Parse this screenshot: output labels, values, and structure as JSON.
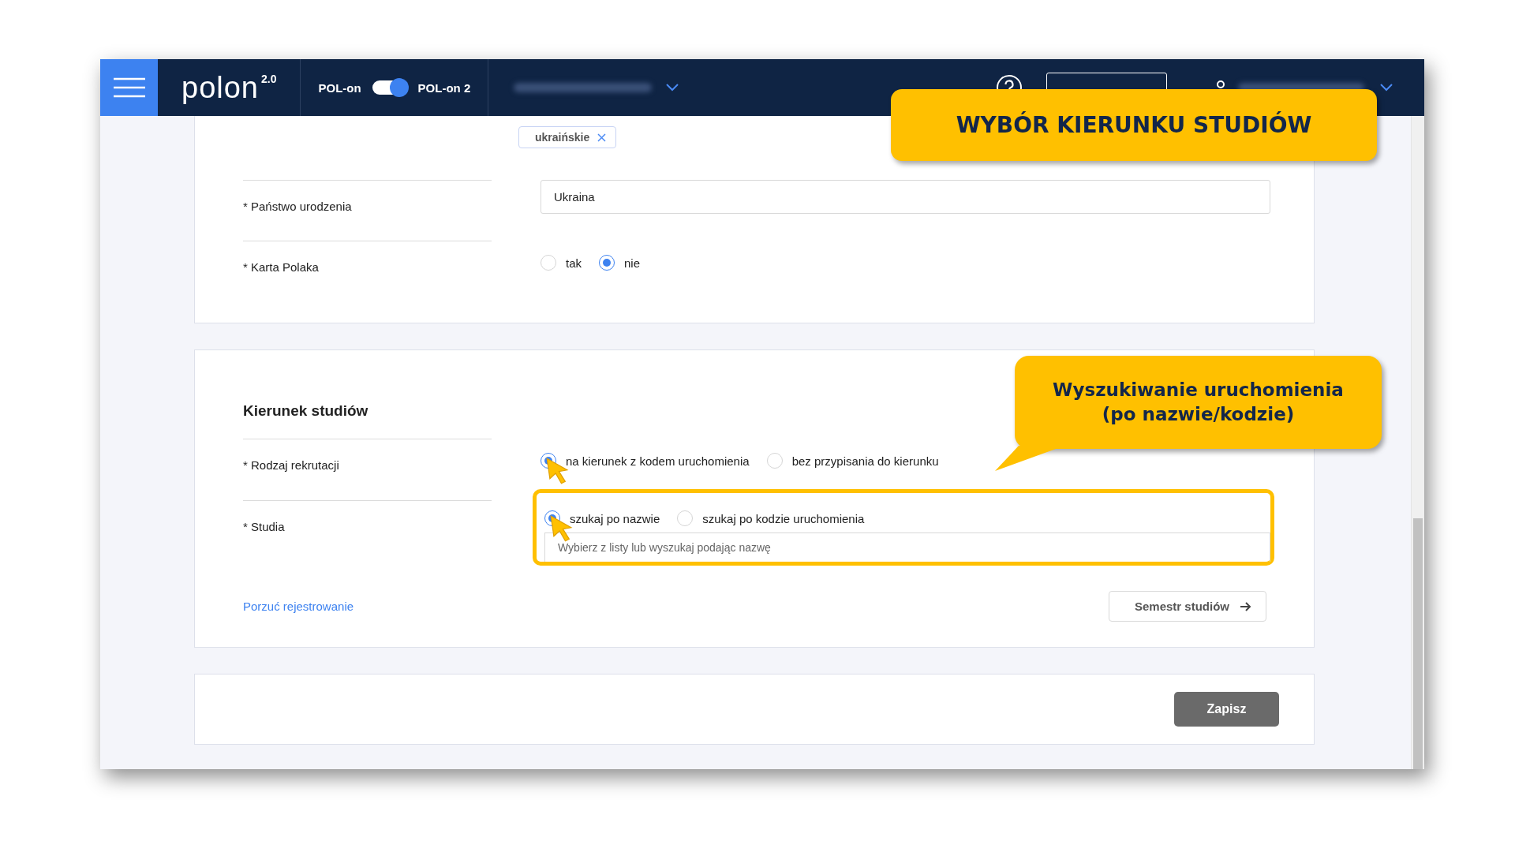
{
  "header": {
    "logo": "polon",
    "logo_version": "2.0",
    "toggle_left": "POL-on",
    "toggle_right": "POL-on 2",
    "toggle_on": true
  },
  "tag": {
    "label": "ukraińskie"
  },
  "personal_fields": [
    {
      "kind": "text",
      "label": "* Państwo urodzenia",
      "value": "Ukraina"
    },
    {
      "kind": "radio",
      "label": "* Karta Polaka",
      "options": [
        {
          "label": "tak",
          "selected": false,
          "cursor": false
        },
        {
          "label": "nie",
          "selected": true,
          "cursor": false
        }
      ]
    }
  ],
  "study_section": {
    "title": "Kierunek studiów",
    "fields": [
      {
        "kind": "radio",
        "label": "* Rodzaj rekrutacji",
        "highlighted": false,
        "options": [
          {
            "label": "na kierunek z kodem uruchomienia",
            "selected": true,
            "cursor": true
          },
          {
            "label": "bez przypisania do kierunku",
            "selected": false,
            "cursor": false
          }
        ]
      },
      {
        "kind": "radio_search",
        "label": "* Studia",
        "highlighted": true,
        "placeholder": "Wybierz z listy lub wyszukaj podając nazwę",
        "options": [
          {
            "label": "szukaj po nazwie",
            "selected": true,
            "cursor": true
          },
          {
            "label": "szukaj po kodzie uruchomienia",
            "selected": false,
            "cursor": false
          }
        ]
      }
    ],
    "abandon_link": "Porzuć rejestrowanie",
    "next_button": "Semestr studiów"
  },
  "footer": {
    "save_button": "Zapisz"
  },
  "annotations": [
    {
      "kind": "banner",
      "text": "WYBÓR KIERUNKU STUDIÓW"
    },
    {
      "kind": "bubble",
      "text": "Wyszukiwanie uruchomienia (po nazwie/kodzie)"
    }
  ]
}
